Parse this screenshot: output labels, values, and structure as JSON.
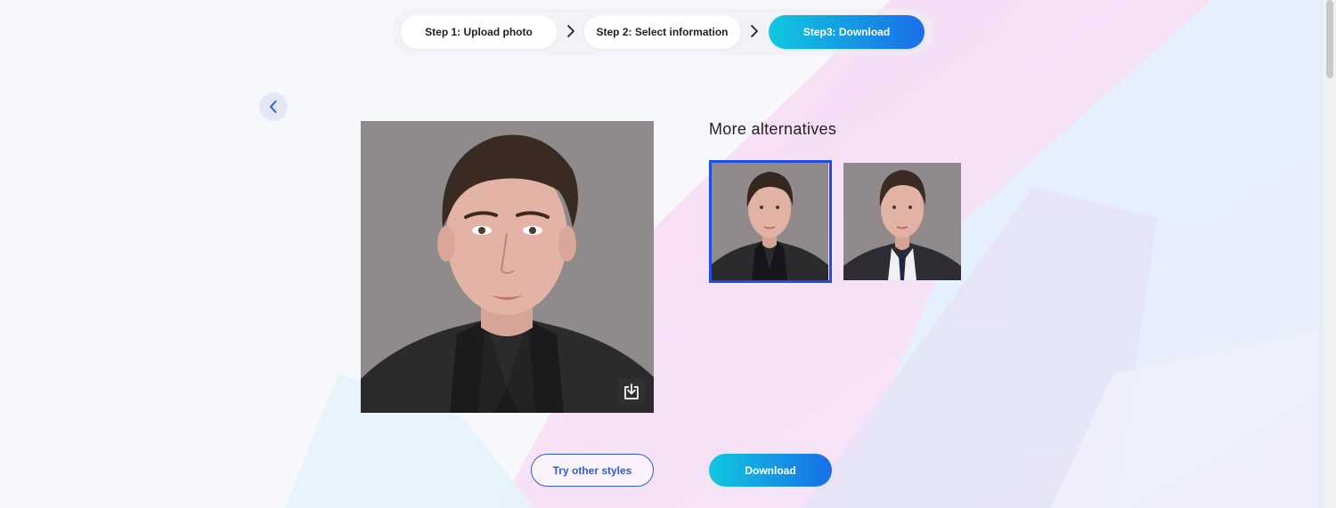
{
  "stepper": {
    "step1_label": "Step 1: Upload photo",
    "step2_label": "Step 2: Select information",
    "step3_label": "Step3: Download"
  },
  "alternatives": {
    "title": "More alternatives",
    "items": [
      {
        "attire": "black suit, black shirt",
        "selected": true
      },
      {
        "attire": "dark suit, white shirt, navy tie",
        "selected": false
      }
    ]
  },
  "actions": {
    "try_label": "Try other styles",
    "download_label": "Download"
  },
  "icons": {
    "back": "chevron-left-icon",
    "step_separator": "chevron-right-icon",
    "photo_download": "download-icon"
  },
  "colors": {
    "accent_blue": "#1f4fe0",
    "gradient_start": "#10c8e0",
    "gradient_end": "#1a6ee8",
    "photo_background": "#8f8a8b"
  }
}
